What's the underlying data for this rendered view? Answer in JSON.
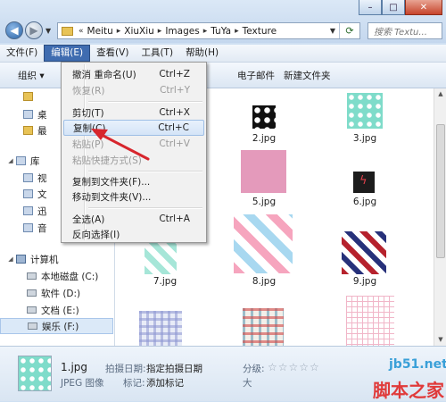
{
  "window": {
    "minimize": "–",
    "maximize": "□",
    "close": "✕"
  },
  "address": {
    "prefix": "«",
    "crumbs": [
      "Meitu",
      "XiuXiu",
      "Images",
      "TuYa",
      "Texture"
    ],
    "search_placeholder": "搜索 Textu..."
  },
  "menubar": [
    {
      "label": "文件(F)"
    },
    {
      "label": "编辑(E)",
      "active": true
    },
    {
      "label": "查看(V)"
    },
    {
      "label": "工具(T)"
    },
    {
      "label": "帮助(H)"
    }
  ],
  "cmdbar": {
    "organize": "组织 ▾",
    "email": "电子邮件",
    "new_folder": "新建文件夹"
  },
  "edit_menu": {
    "items": [
      {
        "label": "撤消 重命名(U)",
        "shortcut": "Ctrl+Z",
        "enabled": true
      },
      {
        "label": "恢复(R)",
        "shortcut": "Ctrl+Y",
        "enabled": false
      },
      {
        "label": "剪切(T)",
        "shortcut": "Ctrl+X",
        "enabled": true
      },
      {
        "label": "复制(C)",
        "shortcut": "Ctrl+C",
        "enabled": true,
        "highlighted": true
      },
      {
        "label": "粘贴(P)",
        "shortcut": "Ctrl+V",
        "enabled": false
      },
      {
        "label": "粘贴快捷方式(S)",
        "shortcut": "",
        "enabled": false
      },
      {
        "label": "复制到文件夹(F)...",
        "shortcut": "",
        "enabled": true
      },
      {
        "label": "移动到文件夹(V)...",
        "shortcut": "",
        "enabled": true
      },
      {
        "label": "全选(A)",
        "shortcut": "Ctrl+A",
        "enabled": true
      },
      {
        "label": "反向选择(I)",
        "shortcut": "",
        "enabled": true
      }
    ]
  },
  "navpane": {
    "library": "库",
    "partial_items": [
      "",
      "桌",
      "最",
      "",
      "视",
      "文",
      "迅",
      "音"
    ],
    "computer": "计算机",
    "drives": [
      "本地磁盘 (C:)",
      "软件 (D:)",
      "文档 (E:)",
      "娱乐 (F:)"
    ]
  },
  "files": [
    {
      "name": "2.jpg",
      "pattern": "black-dots"
    },
    {
      "name": "3.jpg",
      "pattern": "teal-dots"
    },
    {
      "name": "5.jpg",
      "pattern": "crosses"
    },
    {
      "name": "6.jpg",
      "pattern": "dark-tile"
    },
    {
      "name": "7.jpg",
      "pattern": "mint"
    },
    {
      "name": "8.jpg",
      "pattern": "pink-stripes"
    },
    {
      "name": "9.jpg",
      "pattern": "flag-stripes"
    }
  ],
  "details": {
    "filename": "1.jpg",
    "filetype": "JPEG 图像",
    "date_label": "拍摄日期:",
    "date_value": "指定拍摄日期",
    "tags_label": "标记:",
    "tags_value": "添加标记",
    "rating_label": "分级:",
    "stars": "☆☆☆☆☆",
    "size_prefix": "大"
  },
  "watermark": {
    "site": "jb51.net",
    "brand": "脚本之家"
  },
  "colors": {
    "menu_active": "#3f6cb0",
    "arrow": "#d7262d"
  }
}
